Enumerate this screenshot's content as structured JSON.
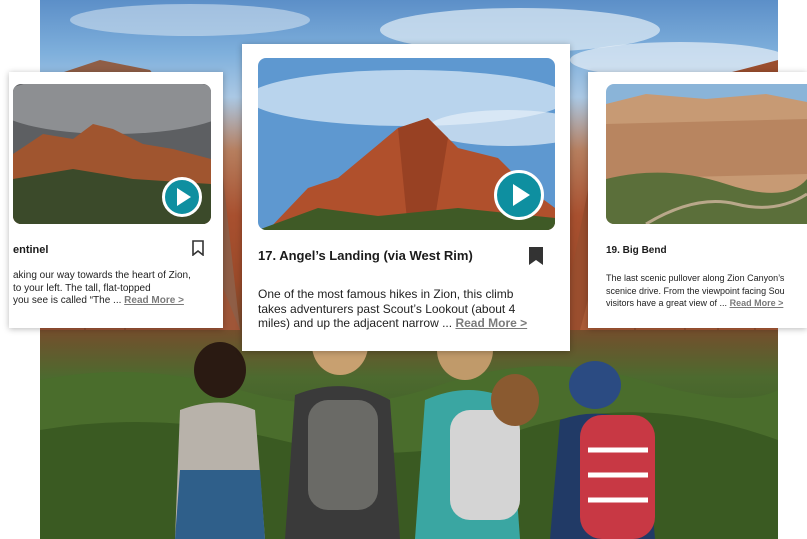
{
  "cards": {
    "left": {
      "title": "entinel",
      "desc_lines": [
        "aking our way towards the heart of Zion,",
        " to your left. The tall, flat-topped",
        "you see is called “The ..."
      ],
      "read_more": "Read More >",
      "bookmark_icon": "bookmark-outline-icon",
      "play_icon": "play-icon"
    },
    "center": {
      "title": "17. Angel’s Landing (via West Rim)",
      "desc_lines": [
        "One of the most famous hikes in Zion, this climb",
        "takes adventurers past Scout’s Lookout (about 4",
        "miles) and up the adjacent narrow ..."
      ],
      "read_more": "Read More >",
      "bookmark_icon": "bookmark-filled-icon",
      "play_icon": "play-icon"
    },
    "right": {
      "title": "19. Big Bend",
      "desc_lines": [
        "The last scenic pullover along Zion Canyon’s",
        "scenice drive. From the viewpoint facing Sou",
        "visitors have a great view of ..."
      ],
      "read_more": "Read More >",
      "play_icon": "play-icon"
    }
  },
  "colors": {
    "accent": "#0e8fa0",
    "bookmark": "#333333",
    "read_more": "#7a7a7a"
  }
}
